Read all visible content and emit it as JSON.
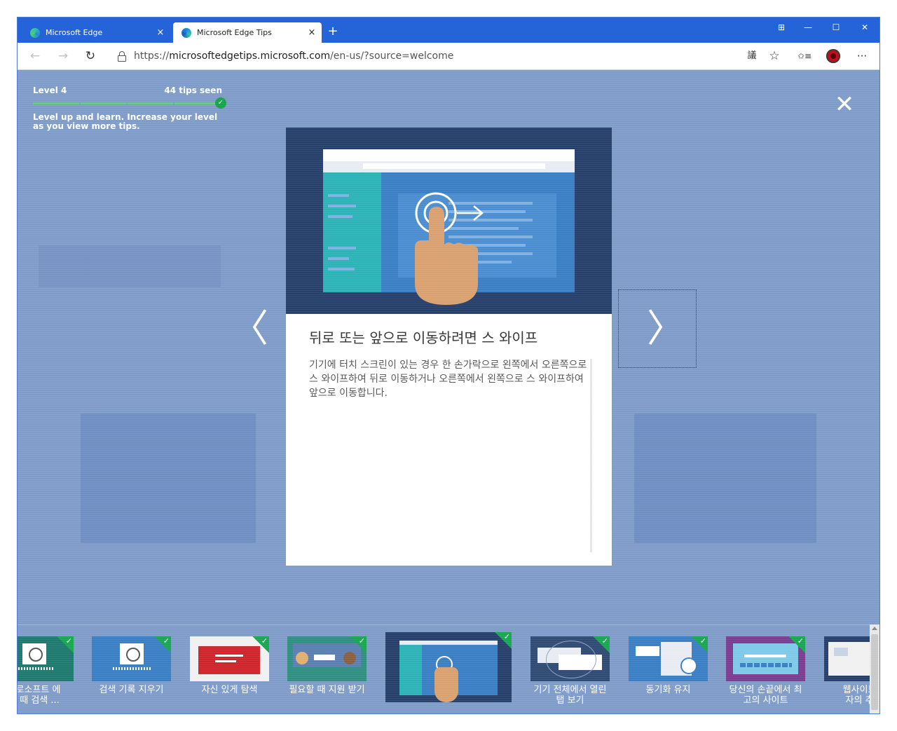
{
  "browser": {
    "tabs": [
      {
        "title": "Microsoft Edge",
        "active": false
      },
      {
        "title": "Microsoft Edge Tips",
        "active": true
      }
    ],
    "new_tab_symbol": "+",
    "close_tab_symbol": "×",
    "window_controls": {
      "tabs_icon": "⊞",
      "minimize": "—",
      "maximize": "☐",
      "close": "✕"
    },
    "nav": {
      "back": "←",
      "forward": "→",
      "refresh": "↻"
    },
    "url_prefix": "https://",
    "url_domain": "microsoftedgetips.microsoft.com",
    "url_path": "/en-us/?source=welcome",
    "toolbar_icons": [
      "read-aloud-icon",
      "favorite-star-icon",
      "favorites-list-icon",
      "profile-avatar-icon",
      "more-menu-icon"
    ],
    "toolbar_glyphs": {
      "read": "議",
      "star": "☆",
      "favorites": "✩≡",
      "more": "···"
    }
  },
  "progress_panel": {
    "level": "Level 4",
    "tips_seen": "44 tips seen",
    "progress_fraction": 1.0,
    "description": "Level up and learn. Increase your level as you view more tips."
  },
  "overlay": {
    "close_symbol": "✕",
    "prev_symbol": "〈",
    "next_symbol": "〉"
  },
  "card": {
    "title": "뒤로 또는 앞으로 이동하려면 스 와이프",
    "body": "기기에 터치 스크린이 있는 경우 한 손가락으로 왼쪽에서 오른쪽으로 스 와이프하여 뒤로 이동하거나 오른쪽에서 왼쪽으로 스 와이프하여 앞으로 이동합니다.",
    "check_symbol": "✓",
    "colors": {
      "image_bg": "#27406b",
      "browser_frame": "#e8ecf2",
      "sidebar": "#2bb3b6",
      "content": "#3a7fc4",
      "hand": "#d9a070",
      "check": "#18a651"
    }
  },
  "thumbnails": [
    {
      "label": "크로소프트 에\n을 때 검색 ...",
      "bg": "#1e7a6e",
      "icon": "history-icon"
    },
    {
      "label": "검색 기록 지우기",
      "bg": "#3a7fc4",
      "icon": "history-icon"
    },
    {
      "label": "자신 있게 탐색",
      "bg": "#f0f0f0",
      "icon": "warning-page-icon"
    },
    {
      "label": "필요할 때 지원 받기",
      "bg": "#2f8f80",
      "icon": "support-people-icon"
    },
    {
      "label": "",
      "bg": "#27406b",
      "icon": "swipe-hand-icon",
      "selected": true
    },
    {
      "label": "기기 전체에서 열린\n탭 보기",
      "bg": "#2f4a73",
      "icon": "devices-tabs-icon"
    },
    {
      "label": "동기화 유지",
      "bg": "#3a7fc4",
      "icon": "sync-icon"
    },
    {
      "label": "당신의 손끝에서 최\n고의 사이트",
      "bg": "#7a3d8f",
      "icon": "top-sites-icon"
    },
    {
      "label": "웹사이트에\n자의 추적",
      "bg": "#27406b",
      "icon": "tracking-icon"
    }
  ]
}
